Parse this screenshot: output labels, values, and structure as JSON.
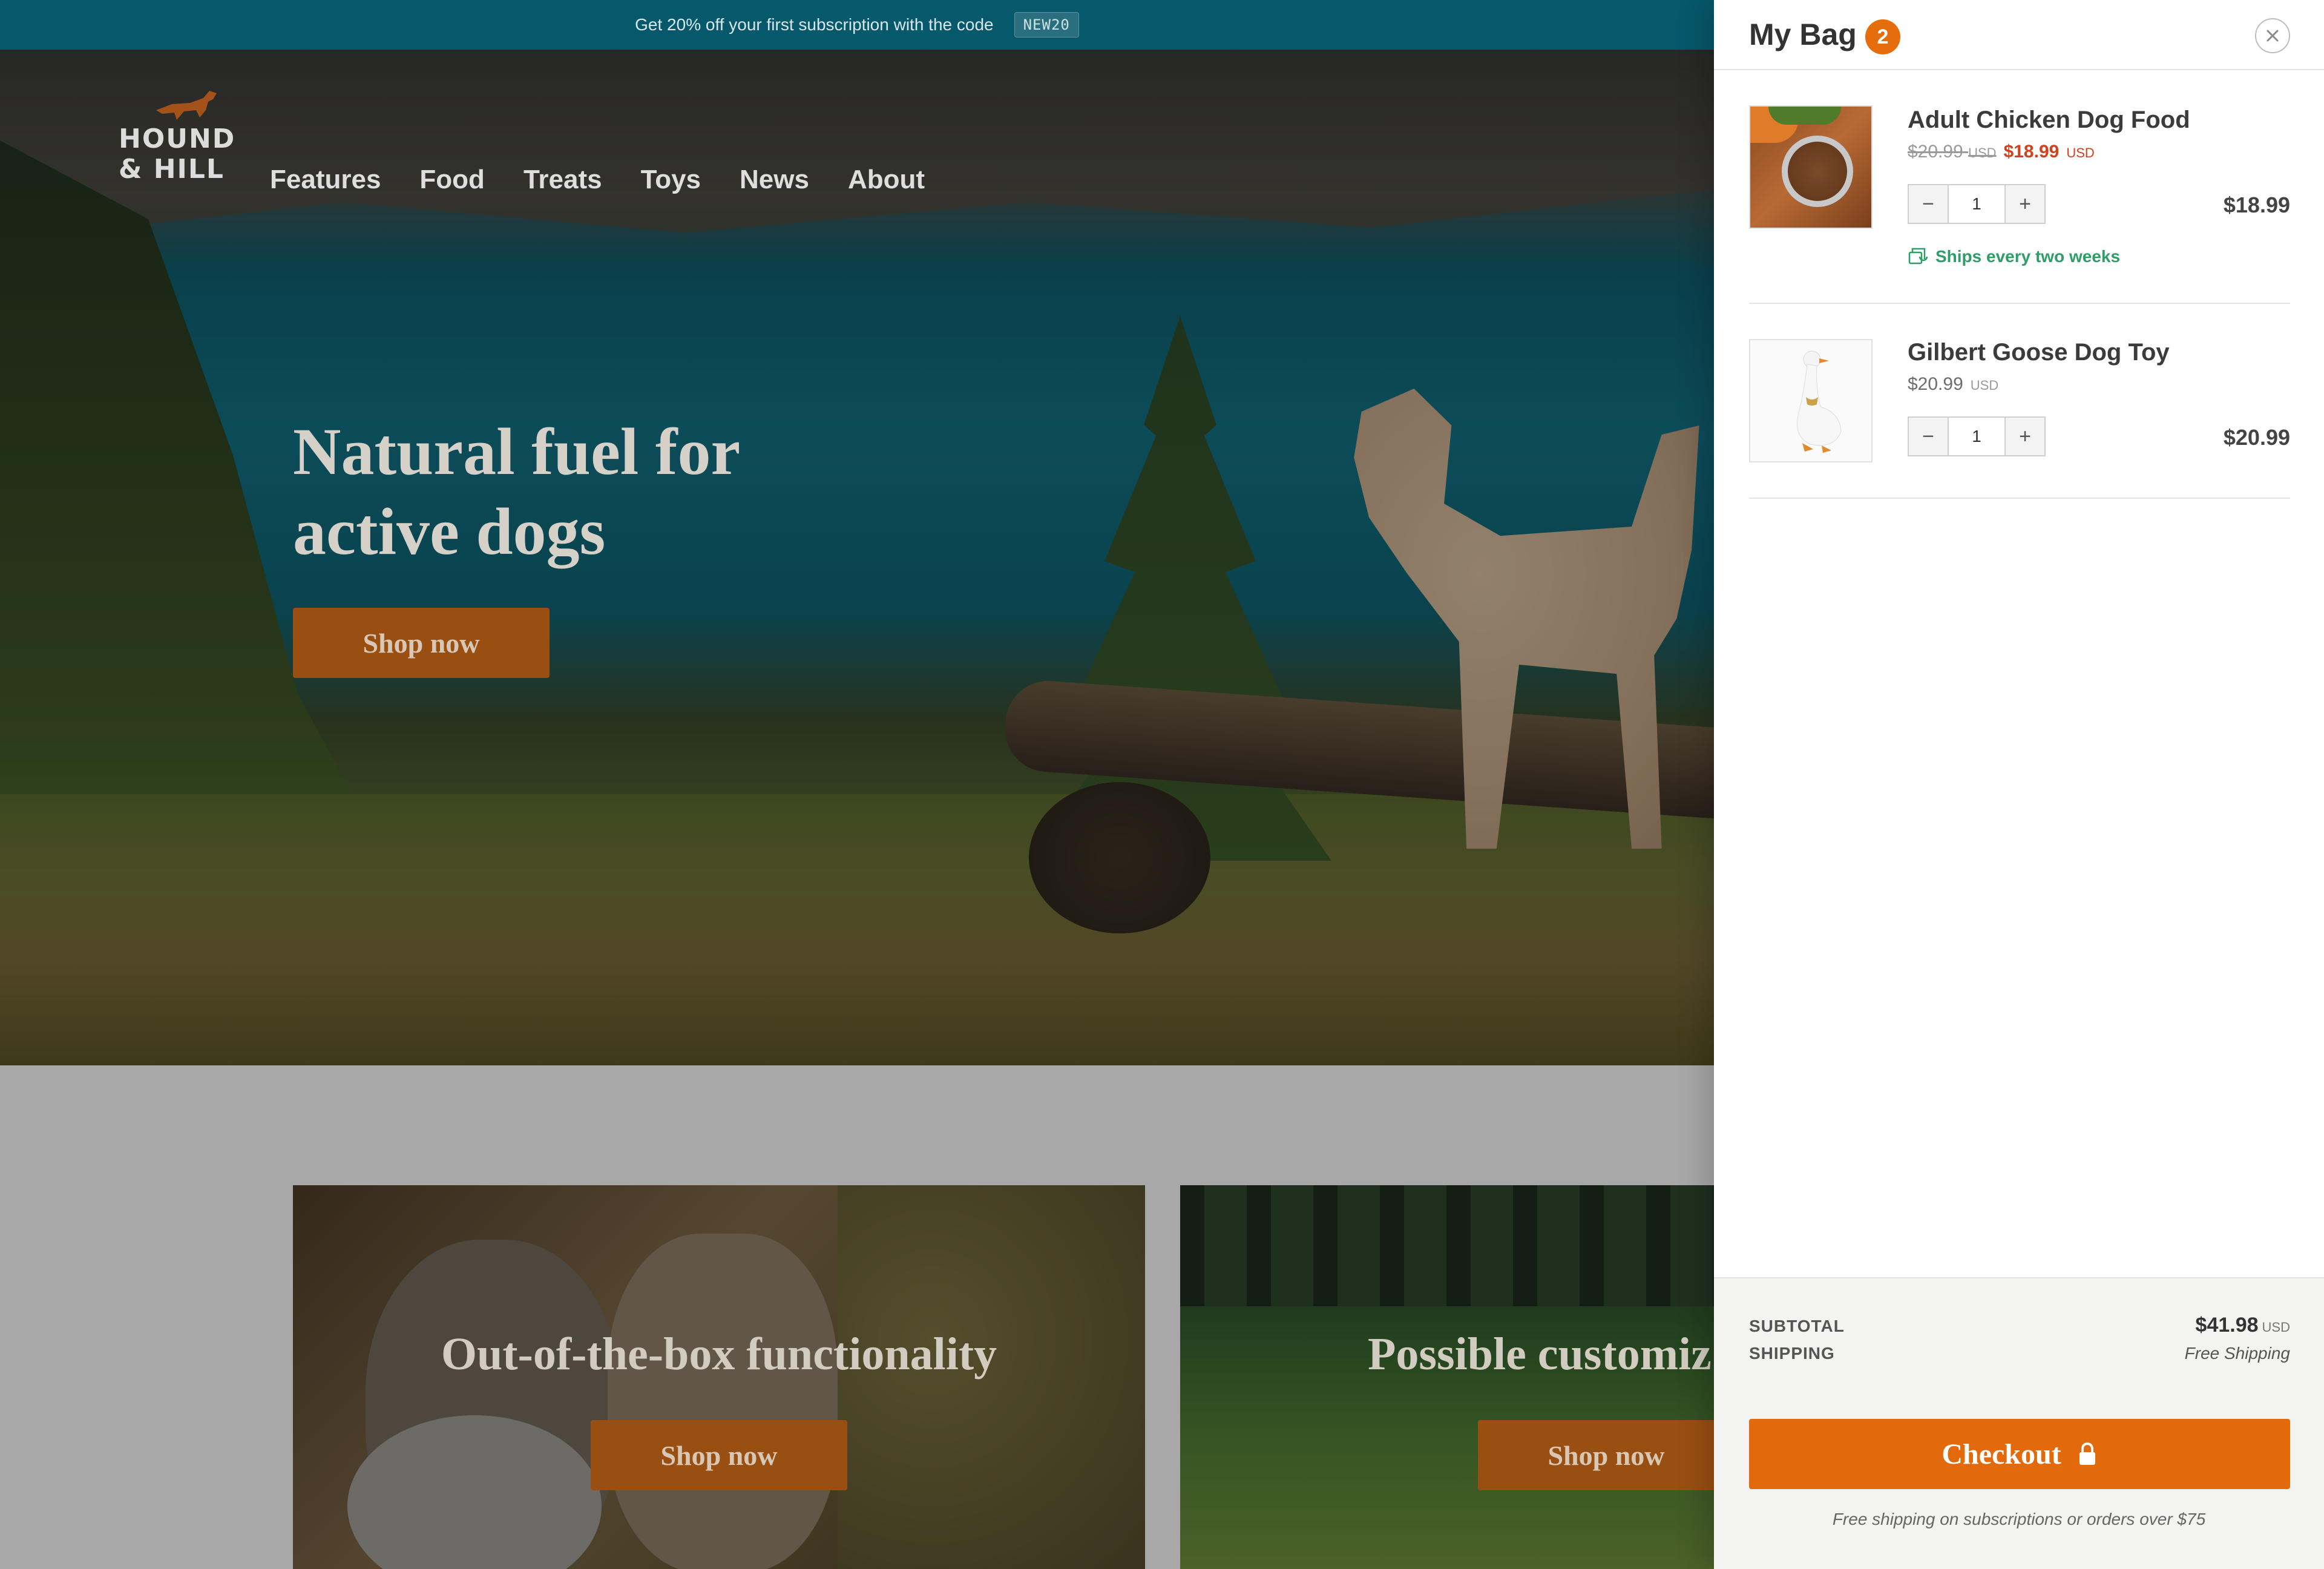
{
  "announcement": {
    "text": "Get 20% off your first subscription with the code",
    "code": "NEW20"
  },
  "brand": {
    "logo_line1": "HOUND",
    "logo_line2": "& HILL",
    "accent_color": "#e36a0b"
  },
  "nav": {
    "items": [
      "Features",
      "Food",
      "Treats",
      "Toys",
      "News",
      "About"
    ]
  },
  "hero": {
    "headline": "Natural fuel for active dogs",
    "cta": "Shop now"
  },
  "cards": [
    {
      "title": "Out-of-the-box functionality",
      "cta": "Shop now"
    },
    {
      "title": "Possible customiz",
      "cta": "Shop now"
    }
  ],
  "cart": {
    "title": "My Bag",
    "count": "2",
    "close_icon": "close-icon",
    "items": [
      {
        "name": "Adult Chicken Dog Food",
        "old_price": "$20.99",
        "old_currency": "USD",
        "price": "$18.99",
        "currency": "USD",
        "qty": "1",
        "line_total": "$18.99",
        "subscription": "Ships every two weeks"
      },
      {
        "name": "Gilbert Goose Dog Toy",
        "price": "$20.99",
        "currency": "USD",
        "qty": "1",
        "line_total": "$20.99"
      }
    ],
    "summary": {
      "subtotal_label": "SUBTOTAL",
      "subtotal_value": "$41.98",
      "subtotal_currency": "USD",
      "shipping_label": "SHIPPING",
      "shipping_value": "Free Shipping"
    },
    "checkout_label": "Checkout",
    "footnote": "Free shipping on subscriptions or orders over $75"
  }
}
